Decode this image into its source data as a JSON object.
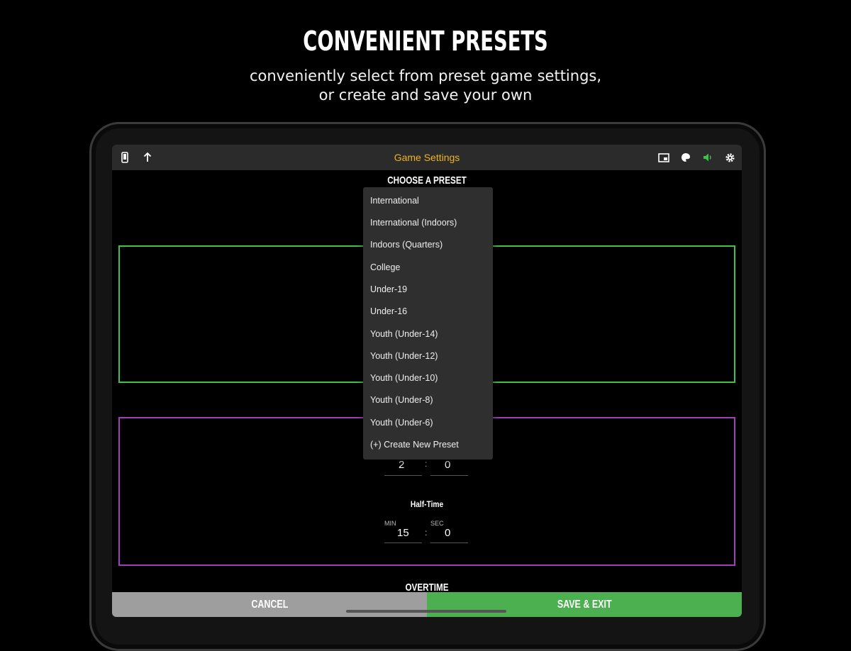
{
  "promo": {
    "headline": "CONVENIENT PRESETS",
    "subline_1": "conveniently select from preset game settings,",
    "subline_2": "or create and save your own"
  },
  "topbar": {
    "title": "Game Settings",
    "icons": [
      "phone-portrait-icon",
      "arrow-up-icon",
      "picture-in-picture-icon",
      "palette-icon",
      "sound-icon",
      "gear-icon"
    ]
  },
  "presets": {
    "heading": "CHOOSE A PRESET",
    "options": [
      "International",
      "International (Indoors)",
      "Indoors (Quarters)",
      "College",
      "Under-19",
      "Under-16",
      "Youth (Under-14)",
      "Youth (Under-12)",
      "Youth (Under-10)",
      "Youth (Under-8)",
      "Youth (Under-6)",
      "(+) Create New Preset"
    ]
  },
  "timeout_fields": {
    "min_value": "2",
    "sec_value": "0"
  },
  "halftime": {
    "label": "Half-Time",
    "min_label": "MIN",
    "sec_label": "SEC",
    "min_value": "15",
    "sec_value": "0"
  },
  "overtime": {
    "label": "OVERTIME"
  },
  "actions": {
    "cancel": "CANCEL",
    "save": "SAVE & EXIT"
  },
  "colors": {
    "accent_title": "#f0b323",
    "green_box": "#3fc24c",
    "purple_box": "#a03fb8",
    "save_button": "#4caf50",
    "cancel_button": "#9e9e9e"
  }
}
